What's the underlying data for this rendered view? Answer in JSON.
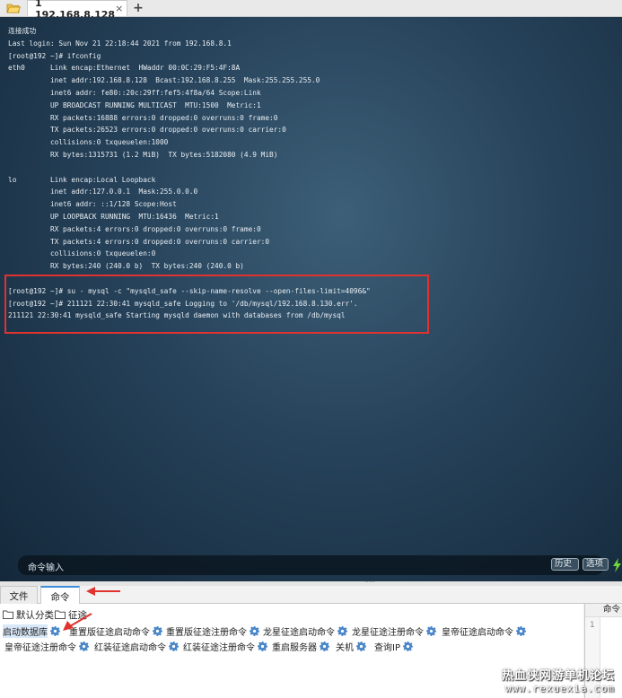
{
  "colors": {
    "terminal_bg": "#26425a",
    "terminal_text": "#e8eef3",
    "highlight": "#e0322f",
    "active_dot": "#2aa52a",
    "gear": "#4a86c8"
  },
  "tabbar": {
    "folder_icon": "folder-open-icon",
    "session_tab": {
      "label": "1 192.168.8.128",
      "close": "×",
      "status_icon": "green-dot"
    },
    "add_label": "+"
  },
  "terminal": {
    "lines": [
      "连接成功",
      "Last login: Sun Nov 21 22:18:44 2021 from 192.168.8.1",
      "[root@192 ~]# ifconfig",
      "eth0      Link encap:Ethernet  HWaddr 00:0C:29:F5:4F:8A",
      "          inet addr:192.168.8.128  Bcast:192.168.8.255  Mask:255.255.255.0",
      "          inet6 addr: fe80::20c:29ff:fef5:4f8a/64 Scope:Link",
      "          UP BROADCAST RUNNING MULTICAST  MTU:1500  Metric:1",
      "          RX packets:16888 errors:0 dropped:0 overruns:0 frame:0",
      "          TX packets:26523 errors:0 dropped:0 overruns:0 carrier:0",
      "          collisions:0 txqueuelen:1000",
      "          RX bytes:1315731 (1.2 MiB)  TX bytes:5182080 (4.9 MiB)",
      "",
      "lo        Link encap:Local Loopback",
      "          inet addr:127.0.0.1  Mask:255.0.0.0",
      "          inet6 addr: ::1/128 Scope:Host",
      "          UP LOOPBACK RUNNING  MTU:16436  Metric:1",
      "          RX packets:4 errors:0 dropped:0 overruns:0 frame:0",
      "          TX packets:4 errors:0 dropped:0 overruns:0 carrier:0",
      "          collisions:0 txqueuelen:0",
      "          RX bytes:240 (240.0 b)  TX bytes:240 (240.0 b)",
      "",
      "[root@192 ~]# su - mysql -c \"mysqld_safe --skip-name-resolve --open-files-limit=4096&\"",
      "[root@192 ~]# 211121 22:30:41 mysqld_safe Logging to '/db/mysql/192.168.8.130.err'.",
      "211121 22:30:41 mysqld_safe Starting mysqld daemon with databases from /db/mysql"
    ],
    "input_label": "命令输入",
    "history_label": "历史",
    "options_label": "选项",
    "bolt_icon": "lightning-bolt-icon"
  },
  "bottom_tabs": {
    "file": "文件",
    "command": "命令"
  },
  "categories": {
    "default": "默认分类",
    "journey": "征途"
  },
  "commands_row1": [
    {
      "label": "启动数据库",
      "selected": true
    },
    {
      "label": "重置版征途启动命令"
    },
    {
      "label": "重置版征途注册命令"
    },
    {
      "label": "龙星征途启动命令"
    },
    {
      "label": "龙星征途注册命令"
    },
    {
      "label": "皇帝征途启动命令"
    }
  ],
  "commands_row2": [
    {
      "label": "皇帝征途注册命令"
    },
    {
      "label": "红装征途启动命令"
    },
    {
      "label": "红装征途注册命令"
    },
    {
      "label": "重启服务器"
    },
    {
      "label": "关机"
    },
    {
      "label": "查询IP"
    }
  ],
  "right_panel": {
    "header": "命令",
    "line_number": "1"
  },
  "watermark": {
    "title": "热血侠网游单机论坛",
    "url": "www.rexuexia.com"
  }
}
